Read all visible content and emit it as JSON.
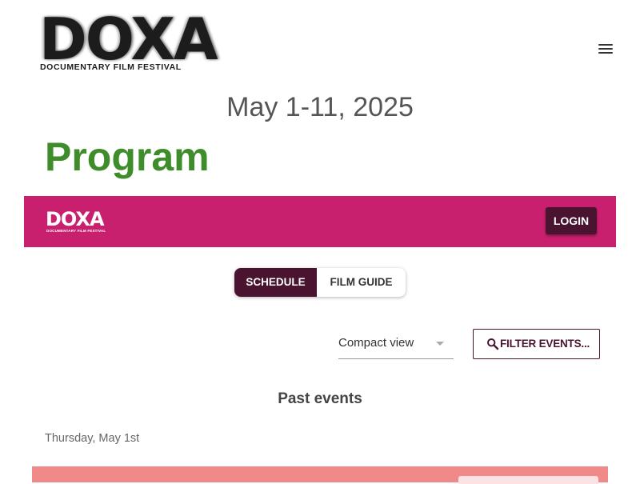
{
  "header": {
    "logo_text": "DOXA",
    "logo_subtitle": "DOCUMENTARY FILM FESTIVAL",
    "menu_icon": "hamburger-menu-icon"
  },
  "festival_dates": "May 1-11, 2025",
  "page_title": "Program",
  "banner": {
    "logo_text": "DOXA",
    "logo_subtitle": "DOCUMENTARY FILM FESTIVAL",
    "login_label": "LOGIN"
  },
  "view_toggle": {
    "schedule_label": "SCHEDULE",
    "film_guide_label": "FILM GUIDE",
    "selected": "SCHEDULE"
  },
  "view_select": {
    "value": "Compact view"
  },
  "filter_button": {
    "label": "FILTER EVENTS...",
    "icon": "search-icon"
  },
  "section_heading": "Past events",
  "day_heading": "Thursday, May 1st",
  "colors": {
    "title_green": "#3f8c2a",
    "banner_magenta": "#c8206e",
    "dark_plum": "#4a1330",
    "event_salmon": "#f08a8a"
  }
}
